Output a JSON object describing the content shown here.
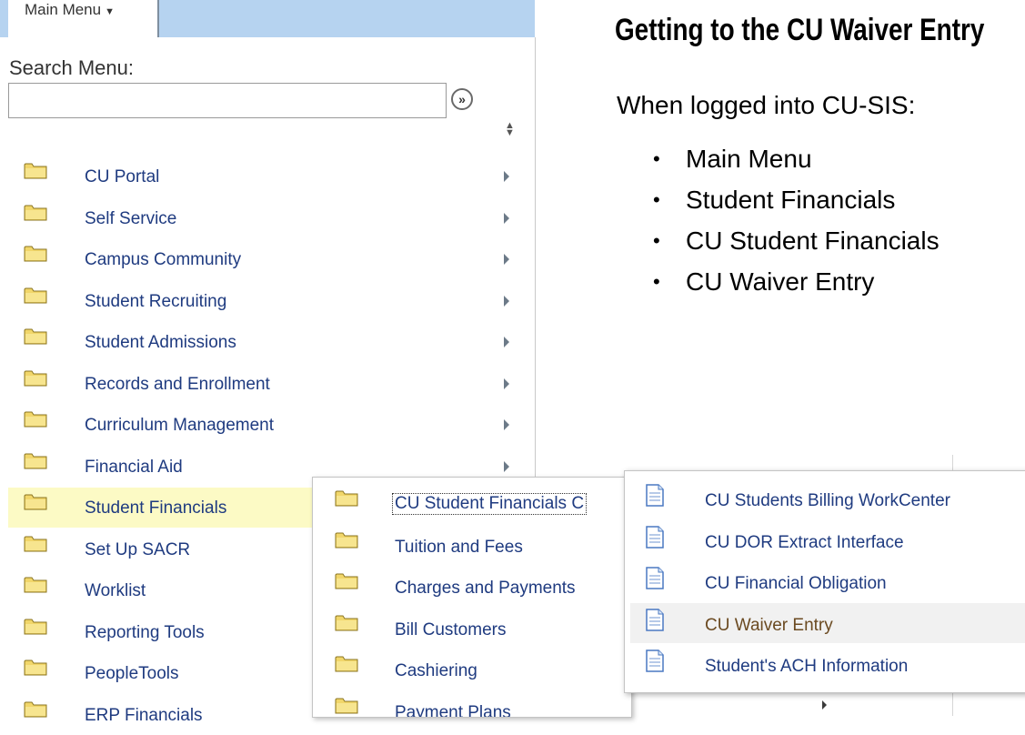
{
  "main_menu": {
    "button_label": "Main Menu",
    "search_label": "Search Menu:",
    "search_value": "",
    "items": [
      {
        "label": "CU Portal"
      },
      {
        "label": "Self Service"
      },
      {
        "label": "Campus Community"
      },
      {
        "label": "Student Recruiting"
      },
      {
        "label": "Student Admissions"
      },
      {
        "label": "Records and Enrollment"
      },
      {
        "label": "Curriculum Management"
      },
      {
        "label": "Financial Aid"
      },
      {
        "label": "Student Financials",
        "active": true
      },
      {
        "label": "Set Up SACR"
      },
      {
        "label": "Worklist"
      },
      {
        "label": "Reporting Tools"
      },
      {
        "label": "PeopleTools"
      },
      {
        "label": "ERP Financials"
      }
    ]
  },
  "submenu_student_financials": {
    "items": [
      {
        "label": "CU Student Financials C",
        "focused": true
      },
      {
        "label": "Tuition and Fees"
      },
      {
        "label": "Charges and Payments"
      },
      {
        "label": "Bill Customers"
      },
      {
        "label": "Cashiering"
      },
      {
        "label": "Payment Plans"
      }
    ]
  },
  "submenu_cu_student_financials": {
    "items": [
      {
        "label": "CU Students Billing WorkCenter"
      },
      {
        "label": "CU DOR Extract Interface"
      },
      {
        "label": "CU Financial Obligation"
      },
      {
        "label": "CU Waiver Entry",
        "hovered": true
      },
      {
        "label": "Student's ACH Information"
      }
    ]
  },
  "slide": {
    "title": "Getting to the CU Waiver Entry",
    "intro": "When logged into CU-SIS:",
    "bullets": [
      "Main Menu",
      "Student Financials",
      "CU Student Financials",
      "CU Waiver Entry"
    ]
  },
  "colors": {
    "header_bar": "#b6d3f0",
    "active_row": "#fcfac5",
    "link_text": "#1f3b80",
    "folder": "#f1d66a"
  }
}
